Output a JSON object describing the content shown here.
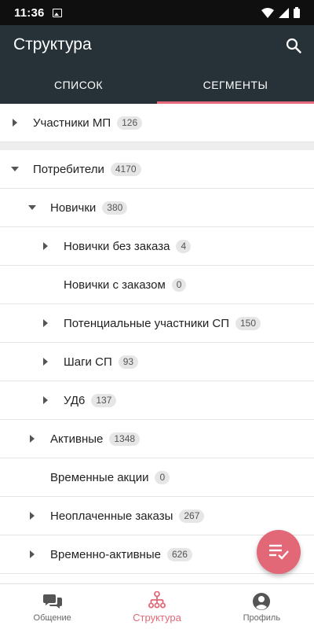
{
  "status_bar": {
    "time": "11:36"
  },
  "app_bar": {
    "title": "Структура"
  },
  "tabs": [
    {
      "label": "СПИСОК",
      "active": false
    },
    {
      "label": "СЕГМЕНТЫ",
      "active": true
    }
  ],
  "rows": [
    {
      "label": "Участники МП",
      "count": "126",
      "expanded": false
    },
    {
      "label": "Потребители",
      "count": "4170",
      "expanded": true
    },
    {
      "label": "Новички",
      "count": "380",
      "expanded": true
    },
    {
      "label": "Новички без заказа",
      "count": "4",
      "expanded": false
    },
    {
      "label": "Новички с заказом",
      "count": "0",
      "expanded": null
    },
    {
      "label": "Потенциальные участники СП",
      "count": "150",
      "expanded": false
    },
    {
      "label": "Шаги СП",
      "count": "93",
      "expanded": false
    },
    {
      "label": "УД6",
      "count": "137",
      "expanded": false
    },
    {
      "label": "Активные",
      "count": "1348",
      "expanded": false
    },
    {
      "label": "Временные акции",
      "count": "0",
      "expanded": null
    },
    {
      "label": "Неоплаченные заказы",
      "count": "267",
      "expanded": false
    },
    {
      "label": "Временно-активные",
      "count": "626",
      "expanded": false
    }
  ],
  "bottom_nav": [
    {
      "label": "Общение",
      "icon": "chat-icon",
      "active": false
    },
    {
      "label": "Структура",
      "icon": "structure-icon",
      "active": true
    },
    {
      "label": "Профиль",
      "icon": "profile-icon",
      "active": false
    }
  ],
  "colors": {
    "app_bar": "#263238",
    "accent": "#e26878"
  }
}
